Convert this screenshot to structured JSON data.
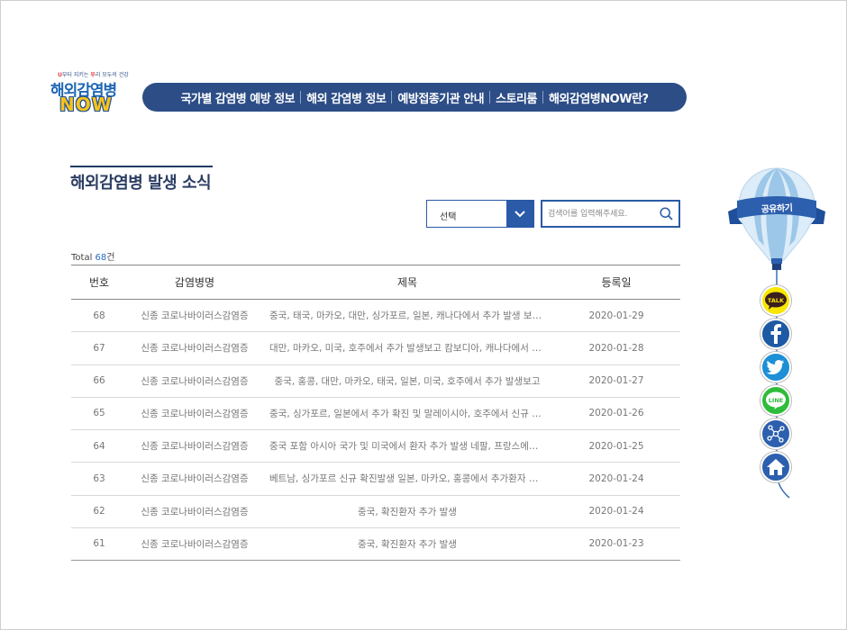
{
  "logo": {
    "tagline_u": "U",
    "tagline_mid": "부터 지키는 ",
    "tagline_uri": "우",
    "tagline_end": "리 모두의 건강",
    "line1": "해외감염병",
    "line2": "NOW"
  },
  "nav": {
    "items": [
      "국가별 감염병 예방 정보",
      "해외 감염병 정보",
      "예방접종기관 안내",
      "스토리룸",
      "해외감염병NOW란?"
    ]
  },
  "page": {
    "title": "해외감염병 발생 소식"
  },
  "search": {
    "select_value": "선택",
    "placeholder": "검색어를 입력해주세요."
  },
  "total": {
    "prefix": "Total ",
    "count": "68",
    "suffix": "건"
  },
  "table": {
    "headers": [
      "번호",
      "감염병명",
      "제목",
      "등록일"
    ],
    "rows": [
      {
        "no": "68",
        "disease": "신종 코로나바이러스감염증",
        "title": "중국, 태국, 마카오, 대만, 싱가포르, 일본, 캐나다에서 추가 발생 보고 및 말레이시아에서 신규 발생",
        "date": "2020-01-29"
      },
      {
        "no": "67",
        "disease": "신종 코로나바이러스감염증",
        "title": "대만, 마카오, 미국, 호주에서 추가 발생보고 캄보디아, 캐나다에서 첫 환자 발생",
        "date": "2020-01-28"
      },
      {
        "no": "66",
        "disease": "신종 코로나바이러스감염증",
        "title": "중국, 홍콩, 대만, 마카오, 태국, 일본, 미국, 호주에서 추가 발생보고",
        "date": "2020-01-27"
      },
      {
        "no": "65",
        "disease": "신종 코로나바이러스감염증",
        "title": "중국, 싱가포르, 일본에서 추가 확진 및 말레이시아, 호주에서 신규 확진 환자 발생",
        "date": "2020-01-26"
      },
      {
        "no": "64",
        "disease": "신종 코로나바이러스감염증",
        "title": "중국 포함 아시아 국가 및 미국에서 환자 추가 발생 네팔, 프랑스에서 신규 발생",
        "date": "2020-01-25"
      },
      {
        "no": "63",
        "disease": "신종 코로나바이러스감염증",
        "title": "베트남, 싱가포르 신규 확진발생 일본, 마카오, 홍콩에서 추가환자 발생",
        "date": "2020-01-24"
      },
      {
        "no": "62",
        "disease": "신종 코로나바이러스감염증",
        "title": "중국, 확진환자 추가 발생",
        "date": "2020-01-24"
      },
      {
        "no": "61",
        "disease": "신종 코로나바이러스감염증",
        "title": "중국, 확진환자 추가 발생",
        "date": "2020-01-23"
      }
    ]
  },
  "share": {
    "label": "공유하기",
    "talk_label": "TALK",
    "line_label": "LINE",
    "buttons": [
      "kakaotalk-icon",
      "facebook-icon",
      "twitter-icon",
      "line-icon",
      "share-network-icon",
      "home-icon"
    ]
  },
  "colors": {
    "navy": "#2c4d86",
    "accent": "#2a5aa8",
    "count": "#2a6cc2",
    "kakao": "#f7e600",
    "facebook": "#1d5aa3",
    "twitter": "#1d8fd6",
    "line": "#2ebd3a"
  }
}
